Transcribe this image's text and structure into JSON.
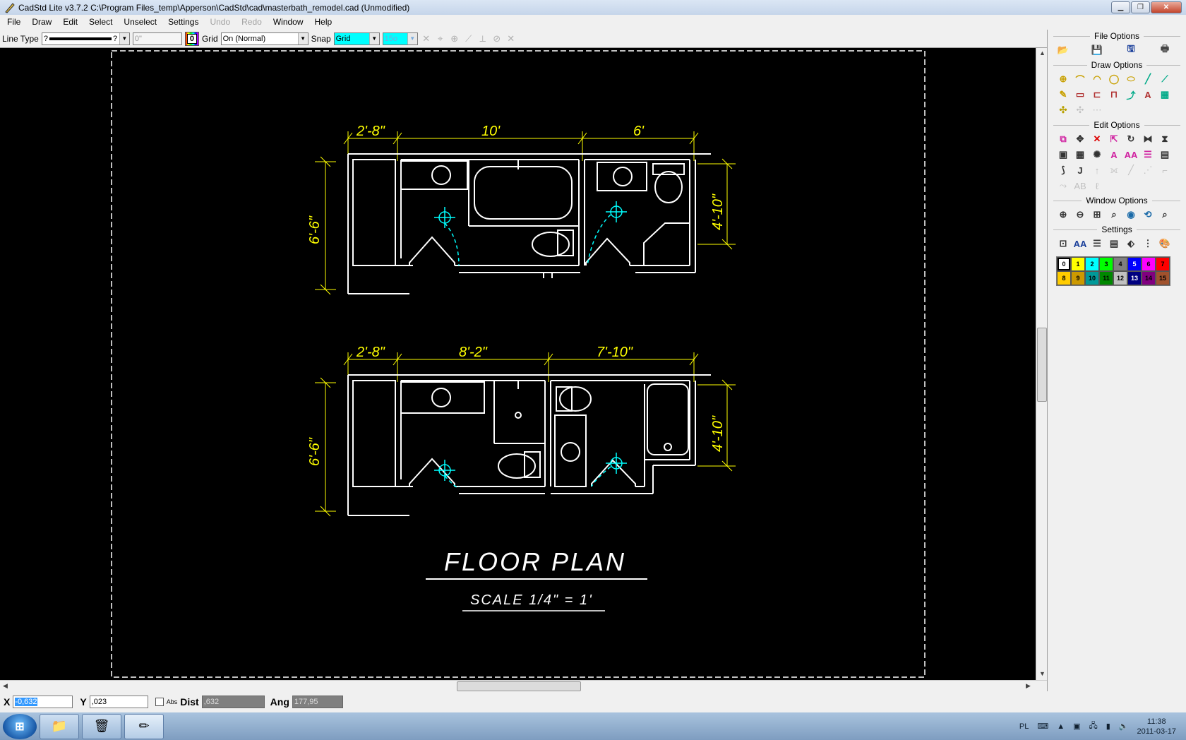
{
  "window": {
    "title": "CadStd Lite v3.7.2  C:\\Program Files_temp\\Apperson\\CadStd\\cad\\masterbath_remodel.cad  (Unmodified)",
    "minimize": "▁",
    "maximize": "❐",
    "close": "✕"
  },
  "menu": [
    "File",
    "Draw",
    "Edit",
    "Select",
    "Unselect",
    "Settings",
    "Undo",
    "Redo",
    "Window",
    "Help"
  ],
  "toolbar": {
    "line_type_label": "Line Type",
    "line_type_value": "?",
    "line_type_value2": "?",
    "line_width": "0\"",
    "color_value": "0",
    "grid_label": "Grid",
    "grid_value": "On (Normal)",
    "snap_label": "Snap",
    "snap_value": "Grid",
    "snap_size": "15o"
  },
  "sidebar": {
    "file_options": "File Options",
    "draw_options": "Draw Options",
    "edit_options": "Edit Options",
    "window_options": "Window Options",
    "settings": "Settings"
  },
  "palette": [
    {
      "n": "0",
      "c": "#ffffff"
    },
    {
      "n": "1",
      "c": "#ffff00"
    },
    {
      "n": "2",
      "c": "#00ffff"
    },
    {
      "n": "3",
      "c": "#00ff00"
    },
    {
      "n": "4",
      "c": "#808080"
    },
    {
      "n": "5",
      "c": "#0000ff"
    },
    {
      "n": "6",
      "c": "#ff00ff"
    },
    {
      "n": "7",
      "c": "#ff0000"
    },
    {
      "n": "8",
      "c": "#ffcc00"
    },
    {
      "n": "9",
      "c": "#cc9900"
    },
    {
      "n": "10",
      "c": "#009999"
    },
    {
      "n": "11",
      "c": "#008800"
    },
    {
      "n": "12",
      "c": "#c0c0c0"
    },
    {
      "n": "13",
      "c": "#000080"
    },
    {
      "n": "14",
      "c": "#800080"
    },
    {
      "n": "15",
      "c": "#a0522d"
    }
  ],
  "drawing": {
    "plan1_dims": [
      "2'-8\"",
      "10'",
      "6'"
    ],
    "plan1_left": "6'-6\"",
    "plan1_right": "4'-10\"",
    "plan2_dims": [
      "2'-8\"",
      "8'-2\"",
      "7'-10\""
    ],
    "plan2_left": "6'-6\"",
    "plan2_right": "4'-10\"",
    "title": "FLOOR PLAN",
    "scale": "SCALE 1/4\" = 1'"
  },
  "status": {
    "x_label": "X",
    "x_value": "-0,632",
    "y_label": "Y",
    "y_value": ",023",
    "abs_label": "Abs",
    "dist_label": "Dist",
    "dist_value": ",632",
    "ang_label": "Ang",
    "ang_value": "177,95"
  },
  "taskbar": {
    "lang": "PL",
    "time": "11:38",
    "date": "2011-03-17"
  }
}
